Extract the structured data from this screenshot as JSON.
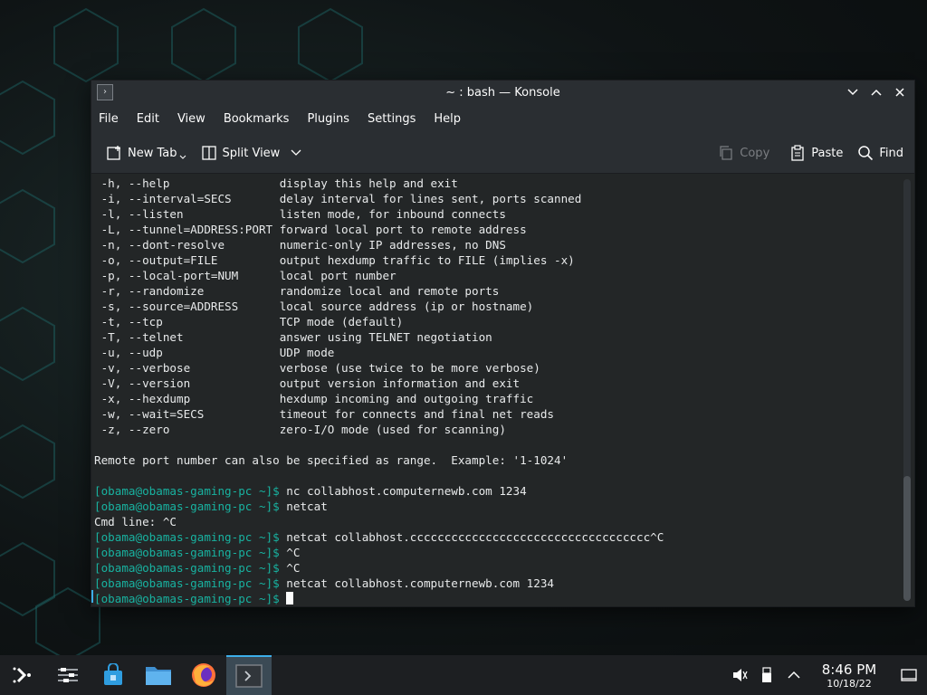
{
  "window": {
    "title": "~ : bash — Konsole"
  },
  "menu": [
    "File",
    "Edit",
    "View",
    "Bookmarks",
    "Plugins",
    "Settings",
    "Help"
  ],
  "toolbar": {
    "new_tab": "New Tab",
    "split_view": "Split View",
    "copy": "Copy",
    "paste": "Paste",
    "find": "Find"
  },
  "terminal": {
    "lines": [
      {
        "text": " -h, --help                display this help and exit"
      },
      {
        "text": " -i, --interval=SECS       delay interval for lines sent, ports scanned"
      },
      {
        "text": " -l, --listen              listen mode, for inbound connects"
      },
      {
        "text": " -L, --tunnel=ADDRESS:PORT forward local port to remote address"
      },
      {
        "text": " -n, --dont-resolve        numeric-only IP addresses, no DNS"
      },
      {
        "text": " -o, --output=FILE         output hexdump traffic to FILE (implies -x)"
      },
      {
        "text": " -p, --local-port=NUM      local port number"
      },
      {
        "text": " -r, --randomize           randomize local and remote ports"
      },
      {
        "text": " -s, --source=ADDRESS      local source address (ip or hostname)"
      },
      {
        "text": " -t, --tcp                 TCP mode (default)"
      },
      {
        "text": " -T, --telnet              answer using TELNET negotiation"
      },
      {
        "text": " -u, --udp                 UDP mode"
      },
      {
        "text": " -v, --verbose             verbose (use twice to be more verbose)"
      },
      {
        "text": " -V, --version             output version information and exit"
      },
      {
        "text": " -x, --hexdump             hexdump incoming and outgoing traffic"
      },
      {
        "text": " -w, --wait=SECS           timeout for connects and final net reads"
      },
      {
        "text": " -z, --zero                zero-I/O mode (used for scanning)"
      },
      {
        "text": ""
      },
      {
        "text": "Remote port number can also be specified as range.  Example: '1-1024'"
      },
      {
        "text": ""
      },
      {
        "prompt": "[obama@obamas-gaming-pc ~]$",
        "text": " nc collabhost.computernewb.com 1234"
      },
      {
        "prompt": "[obama@obamas-gaming-pc ~]$",
        "text": " netcat"
      },
      {
        "text": "Cmd line: ^C"
      },
      {
        "prompt": "[obama@obamas-gaming-pc ~]$",
        "text": " netcat collabhost.ccccccccccccccccccccccccccccccccccc^C"
      },
      {
        "prompt": "[obama@obamas-gaming-pc ~]$",
        "text": " ^C"
      },
      {
        "prompt": "[obama@obamas-gaming-pc ~]$",
        "text": " ^C"
      },
      {
        "prompt": "[obama@obamas-gaming-pc ~]$",
        "text": " netcat collabhost.computernewb.com 1234"
      },
      {
        "prompt": "[obama@obamas-gaming-pc ~]$",
        "text": " ",
        "cursor": true
      }
    ]
  },
  "taskbar": {
    "items": [
      {
        "name": "app-launcher",
        "icon": "app-launcher-icon"
      },
      {
        "name": "system-settings",
        "icon": "sliders-icon"
      },
      {
        "name": "discover-store",
        "icon": "shopping-bag-icon"
      },
      {
        "name": "dolphin-file-manager",
        "icon": "folder-icon"
      },
      {
        "name": "firefox",
        "icon": "firefox-icon"
      },
      {
        "name": "konsole",
        "icon": "terminal-icon",
        "active": true
      }
    ],
    "tray": {
      "icons": [
        "volume-muted-icon",
        "usb-device-icon",
        "chevron-up-icon"
      ],
      "time": "8:46 PM",
      "date": "10/18/22"
    }
  },
  "colors": {
    "prompt": "#18b2a0",
    "terminal_bg": "#232627",
    "accent": "#3daee9"
  }
}
